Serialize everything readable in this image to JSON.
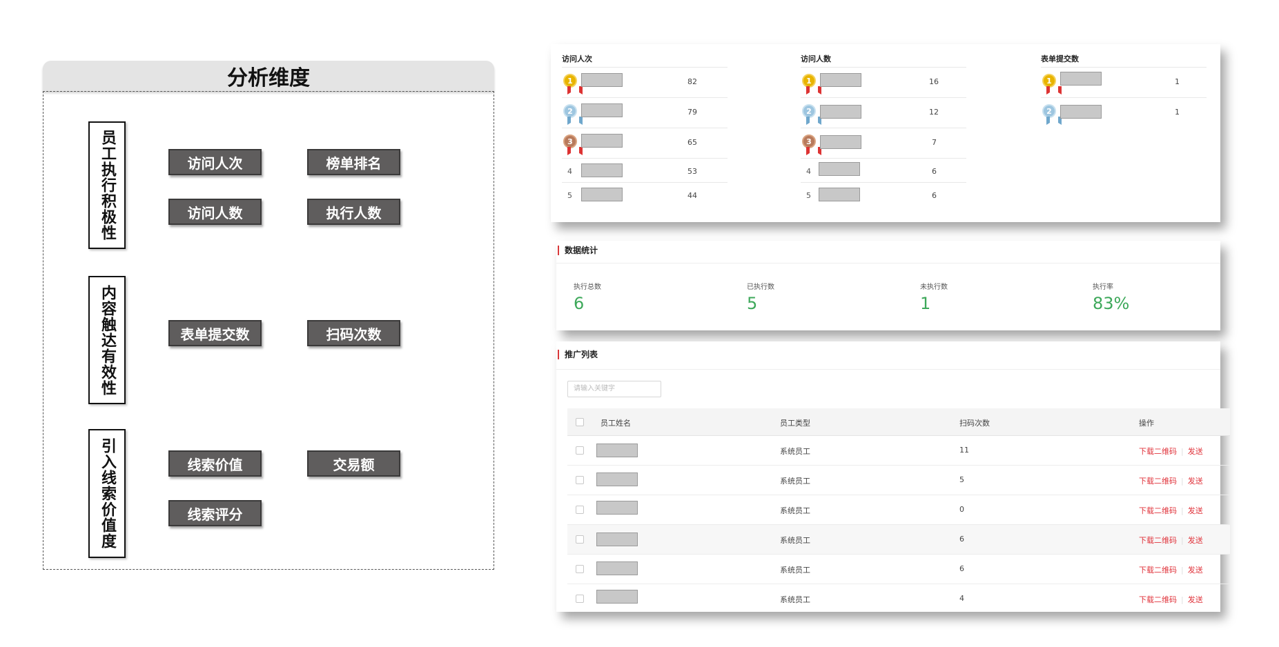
{
  "analysis": {
    "title": "分析维度",
    "groups": [
      {
        "label": "员工执行积极性",
        "tags": [
          "访问人次",
          "榜单排名",
          "访问人数",
          "执行人数"
        ]
      },
      {
        "label": "内容触达有效性",
        "tags": [
          "表单提交数",
          "扫码次数"
        ]
      },
      {
        "label": "引入线索价值度",
        "tags": [
          "线索价值",
          "交易额",
          "线索评分"
        ]
      }
    ]
  },
  "rankings": [
    {
      "title": "访问人次",
      "rows": [
        {
          "rank": "1",
          "value": "82"
        },
        {
          "rank": "2",
          "value": "79"
        },
        {
          "rank": "3",
          "value": "65"
        },
        {
          "rank": "4",
          "value": "53"
        },
        {
          "rank": "5",
          "value": "44"
        }
      ]
    },
    {
      "title": "访问人数",
      "rows": [
        {
          "rank": "1",
          "value": "16"
        },
        {
          "rank": "2",
          "value": "12"
        },
        {
          "rank": "3",
          "value": "7"
        },
        {
          "rank": "4",
          "value": "6"
        },
        {
          "rank": "5",
          "value": "6"
        }
      ]
    },
    {
      "title": "表单提交数",
      "rows": [
        {
          "rank": "1",
          "value": "1"
        },
        {
          "rank": "2",
          "value": "1"
        }
      ]
    }
  ],
  "stats": {
    "title": "数据统计",
    "items": [
      {
        "label": "执行总数",
        "value": "6"
      },
      {
        "label": "已执行数",
        "value": "5"
      },
      {
        "label": "未执行数",
        "value": "1"
      },
      {
        "label": "执行率",
        "value": "83%"
      }
    ]
  },
  "promo": {
    "title": "推广列表",
    "search_placeholder": "请输入关键字",
    "columns": [
      "员工姓名",
      "员工类型",
      "扫码次数",
      "操作"
    ],
    "rows": [
      {
        "type": "系统员工",
        "scans": "11"
      },
      {
        "type": "系统员工",
        "scans": "5"
      },
      {
        "type": "系统员工",
        "scans": "0"
      },
      {
        "type": "系统员工",
        "scans": "6"
      },
      {
        "type": "系统员工",
        "scans": "6"
      },
      {
        "type": "系统员工",
        "scans": "4"
      }
    ],
    "action_download": "下载二维码",
    "action_send": "发送"
  },
  "colors": {
    "accent_green": "#3da85a",
    "accent_red": "#e0323a",
    "tag_gray": "#5f5d5d"
  }
}
